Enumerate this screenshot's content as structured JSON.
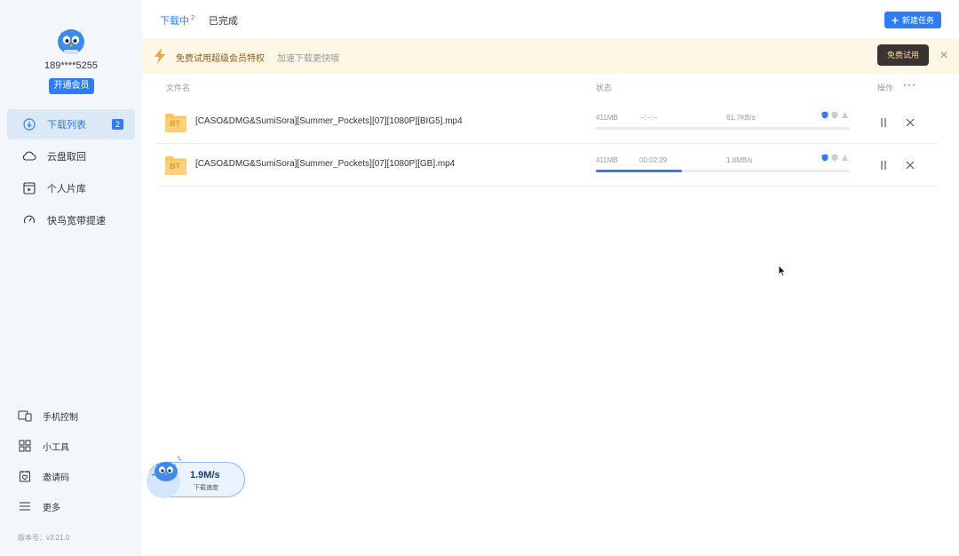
{
  "sidebar": {
    "phone": "189****5255",
    "vip_button": "开通会员",
    "nav": [
      {
        "label": "下载列表",
        "icon": "download-circle-icon",
        "badge": "2",
        "active": true
      },
      {
        "label": "云盘取回",
        "icon": "cloud-icon"
      },
      {
        "label": "个人片库",
        "icon": "video-library-icon"
      },
      {
        "label": "快鸟宽带提速",
        "icon": "speedometer-icon"
      }
    ],
    "bottom_nav": [
      {
        "label": "手机控制",
        "icon": "phone-control-icon"
      },
      {
        "label": "小工具",
        "icon": "grid-tools-icon"
      },
      {
        "label": "邀请码",
        "icon": "invite-code-icon"
      },
      {
        "label": "更多",
        "icon": "menu-icon"
      }
    ],
    "version": "版本号：v3.21.0"
  },
  "header": {
    "tabs": [
      {
        "label": "下载中",
        "count": "2",
        "active": true
      },
      {
        "label": "已完成"
      }
    ],
    "new_task_button": "新建任务"
  },
  "promo": {
    "title": "免费试用超级会员特权",
    "subtitle": "加速下载更快哦",
    "button": "免费试用"
  },
  "table": {
    "columns": {
      "name": "文件名",
      "status": "状态",
      "actions": "操作"
    },
    "rows": [
      {
        "icon_text": "BT",
        "name": "[CASO&DMG&SumiSora][Summer_Pockets][07][1080P][BIG5].mp4",
        "size": "411MB",
        "time": "--:--:--",
        "speed": "61.7KB/s",
        "progress": 0
      },
      {
        "icon_text": "BT",
        "name": "[CASO&DMG&SumiSora][Summer_Pockets][07][1080P][GB].mp4",
        "size": "411MB",
        "time": "00:02:29",
        "speed": "1.8MB/s",
        "progress": 0.34
      }
    ]
  },
  "speed_widget": {
    "value": "1.9M/s",
    "label": "下载速度"
  },
  "colors": {
    "accent": "#2f7df6",
    "sidebar_bg": "#f3f6fa",
    "promo_bg": "#fef7e6",
    "folder": "#fcc45c"
  }
}
